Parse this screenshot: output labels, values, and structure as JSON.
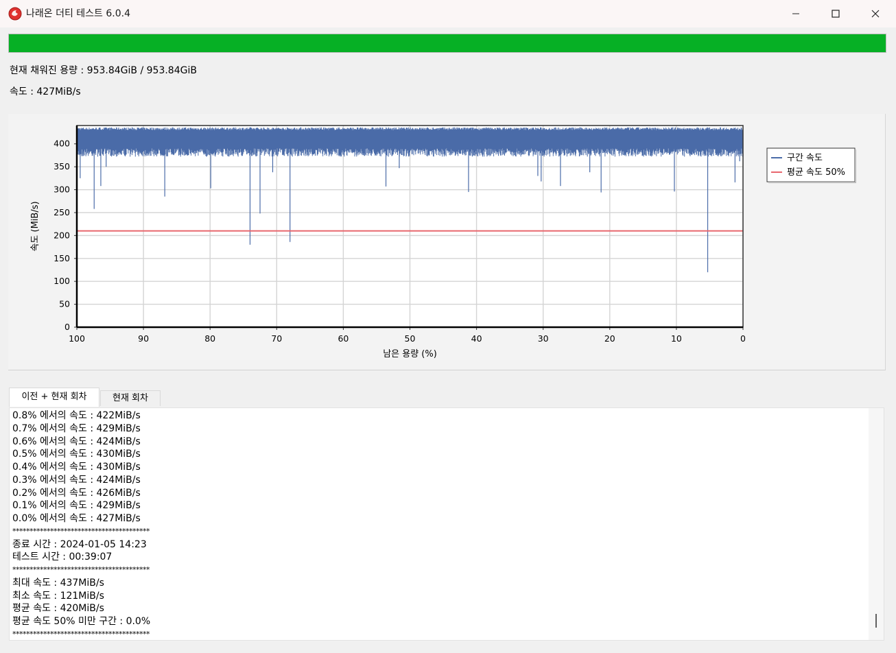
{
  "window": {
    "title": "나래온 더티 테스트 6.0.4",
    "icon": "app-logo-icon",
    "controls": [
      "minimize-icon",
      "maximize-icon",
      "close-icon"
    ]
  },
  "progress": {
    "percent": 100,
    "color": "#06b025"
  },
  "status": {
    "filled_capacity": "현재 채워진 용량 : 953.84GiB / 953.84GiB",
    "speed": "속도 : 427MiB/s"
  },
  "chart_data": {
    "type": "line",
    "xlabel": "남은 용량 (%)",
    "ylabel": "속도 (MiB/s)",
    "xlim": [
      100,
      0
    ],
    "ylim": [
      0,
      440
    ],
    "xticks": [
      "100",
      "90",
      "80",
      "70",
      "60",
      "50",
      "40",
      "30",
      "20",
      "10",
      "0"
    ],
    "yticks": [
      "0",
      "50",
      "100",
      "150",
      "200",
      "250",
      "300",
      "350",
      "400"
    ],
    "grid": true,
    "legend_position": "right",
    "series": [
      {
        "name": "구간 속도",
        "color": "#4a6ba8",
        "baseline": {
          "low": 390,
          "high": 430
        },
        "dips": [
          [
            97.4,
            258
          ],
          [
            99.5,
            325
          ],
          [
            96.4,
            308
          ],
          [
            95.6,
            350
          ],
          [
            86.8,
            285
          ],
          [
            79.9,
            303
          ],
          [
            74.0,
            180
          ],
          [
            72.5,
            248
          ],
          [
            70.6,
            338
          ],
          [
            68.0,
            186
          ],
          [
            53.6,
            307
          ],
          [
            51.6,
            347
          ],
          [
            41.2,
            295
          ],
          [
            30.8,
            330
          ],
          [
            30.3,
            318
          ],
          [
            27.4,
            308
          ],
          [
            23.0,
            338
          ],
          [
            21.3,
            294
          ],
          [
            10.3,
            296
          ],
          [
            5.3,
            120
          ],
          [
            1.2,
            316
          ],
          [
            0.5,
            362
          ]
        ]
      },
      {
        "name": "평균 속도 50%",
        "color": "#e8666d",
        "values": [
          210,
          210
        ]
      }
    ]
  },
  "tabs": [
    {
      "label": "이전 + 현재 회차",
      "active": true
    },
    {
      "label": "현재 회차",
      "active": false
    }
  ],
  "log": [
    "0.8% 에서의 속도 : 422MiB/s",
    "0.7% 에서의 속도 : 429MiB/s",
    "0.6% 에서의 속도 : 424MiB/s",
    "0.5% 에서의 속도 : 430MiB/s",
    "0.4% 에서의 속도 : 430MiB/s",
    "0.3% 에서의 속도 : 424MiB/s",
    "0.2% 에서의 속도 : 426MiB/s",
    "0.1% 에서의 속도 : 429MiB/s",
    "0.0% 에서의 속도 : 427MiB/s",
    "****************************************",
    "종료 시간 : 2024-01-05 14:23",
    "테스트 시간 : 00:39:07",
    "****************************************",
    "최대 속도 : 437MiB/s",
    "최소 속도 : 121MiB/s",
    "평균 속도 : 420MiB/s",
    "평균 속도 50% 미만 구간 : 0.0%",
    "****************************************"
  ]
}
